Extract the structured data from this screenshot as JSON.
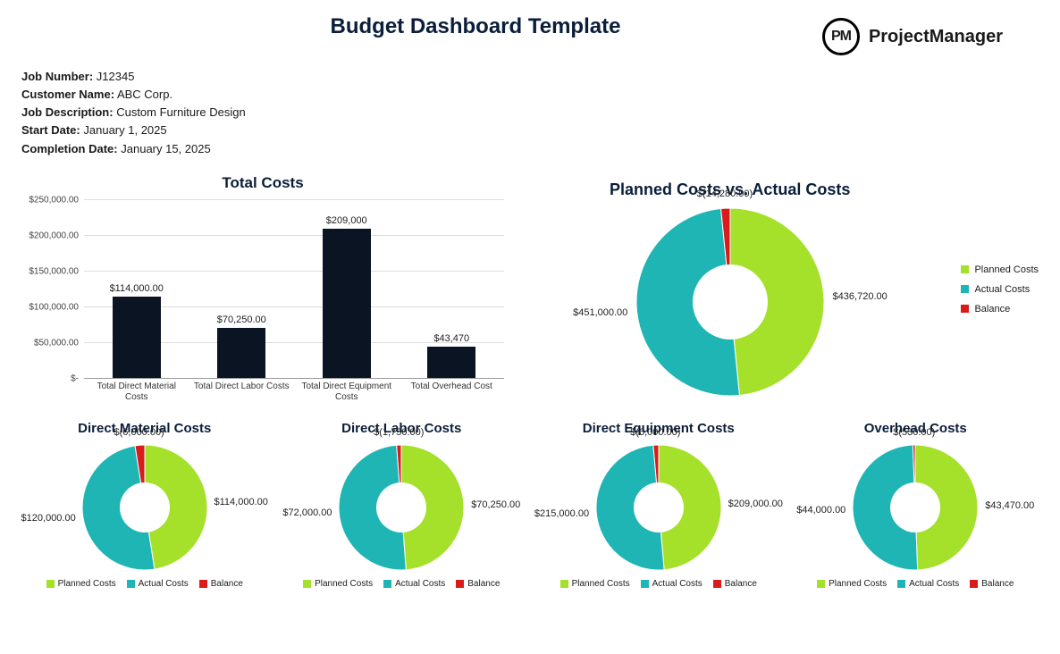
{
  "title": "Budget Dashboard Template",
  "brand": {
    "abbrev": "PM",
    "name": "ProjectManager"
  },
  "meta": {
    "job_number_label": "Job Number:",
    "job_number": "J12345",
    "customer_label": "Customer Name:",
    "customer": "ABC Corp.",
    "desc_label": "Job Description:",
    "desc": "Custom Furniture Design",
    "start_label": "Start Date:",
    "start": "January 1, 2025",
    "end_label": "Completion Date:",
    "end": "January 15, 2025"
  },
  "colors": {
    "planned": "#a5e02a",
    "actual": "#1fb5b5",
    "balance": "#d91b1b",
    "bar": "#0b1423"
  },
  "legend": {
    "planned": "Planned Costs",
    "actual": "Actual Costs",
    "balance": "Balance"
  },
  "chart_data": [
    {
      "id": "total_costs",
      "type": "bar",
      "title": "Total Costs",
      "categories": [
        "Total Direct Material Costs",
        "Total Direct Labor Costs",
        "Total Direct Equipment Costs",
        "Total Overhead Cost"
      ],
      "values": [
        114000,
        70250,
        209000,
        43470
      ],
      "value_labels": [
        "$114,000.00",
        "$70,250.00",
        "$209,000",
        "$43,470"
      ],
      "yticks": [
        0,
        50000,
        100000,
        150000,
        200000,
        250000
      ],
      "ytick_labels": [
        "$-",
        "$50,000.00",
        "$100,000.00",
        "$150,000.00",
        "$200,000.00",
        "$250,000.00"
      ],
      "ylim": [
        0,
        250000
      ]
    },
    {
      "id": "planned_vs_actual",
      "type": "pie",
      "title": "Planned Costs vs. Actual Costs",
      "series": [
        {
          "name": "Planned Costs",
          "value": 436720,
          "label": "$436,720.00"
        },
        {
          "name": "Actual Costs",
          "value": 451000,
          "label": "$451,000.00"
        },
        {
          "name": "Balance",
          "value": 14280,
          "label": "$(14,280.00)"
        }
      ]
    },
    {
      "id": "direct_material",
      "type": "pie",
      "title": "Direct Material Costs",
      "series": [
        {
          "name": "Planned Costs",
          "value": 114000,
          "label": "$114,000.00"
        },
        {
          "name": "Actual Costs",
          "value": 120000,
          "label": "$120,000.00"
        },
        {
          "name": "Balance",
          "value": 6000,
          "label": "$(6,000.00)"
        }
      ]
    },
    {
      "id": "direct_labor",
      "type": "pie",
      "title": "Direct Labor Costs",
      "series": [
        {
          "name": "Planned Costs",
          "value": 70250,
          "label": "$70,250.00"
        },
        {
          "name": "Actual Costs",
          "value": 72000,
          "label": "$72,000.00"
        },
        {
          "name": "Balance",
          "value": 1750,
          "label": "$(1,750.00)"
        }
      ]
    },
    {
      "id": "direct_equipment",
      "type": "pie",
      "title": "Direct Equipment Costs",
      "series": [
        {
          "name": "Planned Costs",
          "value": 209000,
          "label": "$209,000.00"
        },
        {
          "name": "Actual Costs",
          "value": 215000,
          "label": "$215,000.00"
        },
        {
          "name": "Balance",
          "value": 6000,
          "label": "$(6,000.00)"
        }
      ]
    },
    {
      "id": "overhead",
      "type": "pie",
      "title": "Overhead Costs",
      "series": [
        {
          "name": "Planned Costs",
          "value": 43470,
          "label": "$43,470.00"
        },
        {
          "name": "Actual Costs",
          "value": 44000,
          "label": "$44,000.00"
        },
        {
          "name": "Balance",
          "value": 530,
          "label": "$(530.00)"
        }
      ]
    }
  ]
}
